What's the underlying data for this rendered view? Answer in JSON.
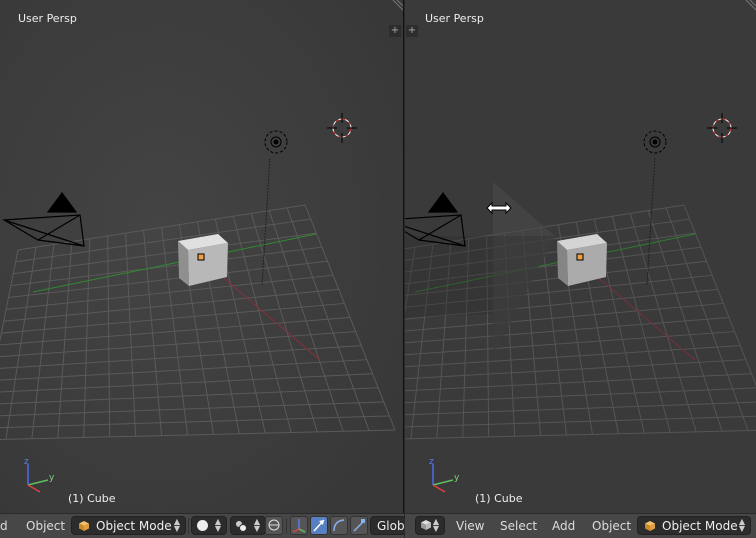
{
  "left_viewport": {
    "title": "User Persp",
    "object_label": "(1) Cube",
    "axis_y": "y",
    "axis_z": "z",
    "plus": "+"
  },
  "right_viewport": {
    "title": "User Persp",
    "object_label": "(1) Cube",
    "axis_y": "y",
    "axis_z": "z",
    "plus": "+"
  },
  "left_header": {
    "menu_partial": "d",
    "menu_object": "Object",
    "mode_dropdown": "Object Mode",
    "orientation_dropdown": "Globa"
  },
  "right_header": {
    "menu_view": "View",
    "menu_select": "Select",
    "menu_add": "Add",
    "menu_object": "Object",
    "mode_dropdown": "Object Mode"
  }
}
